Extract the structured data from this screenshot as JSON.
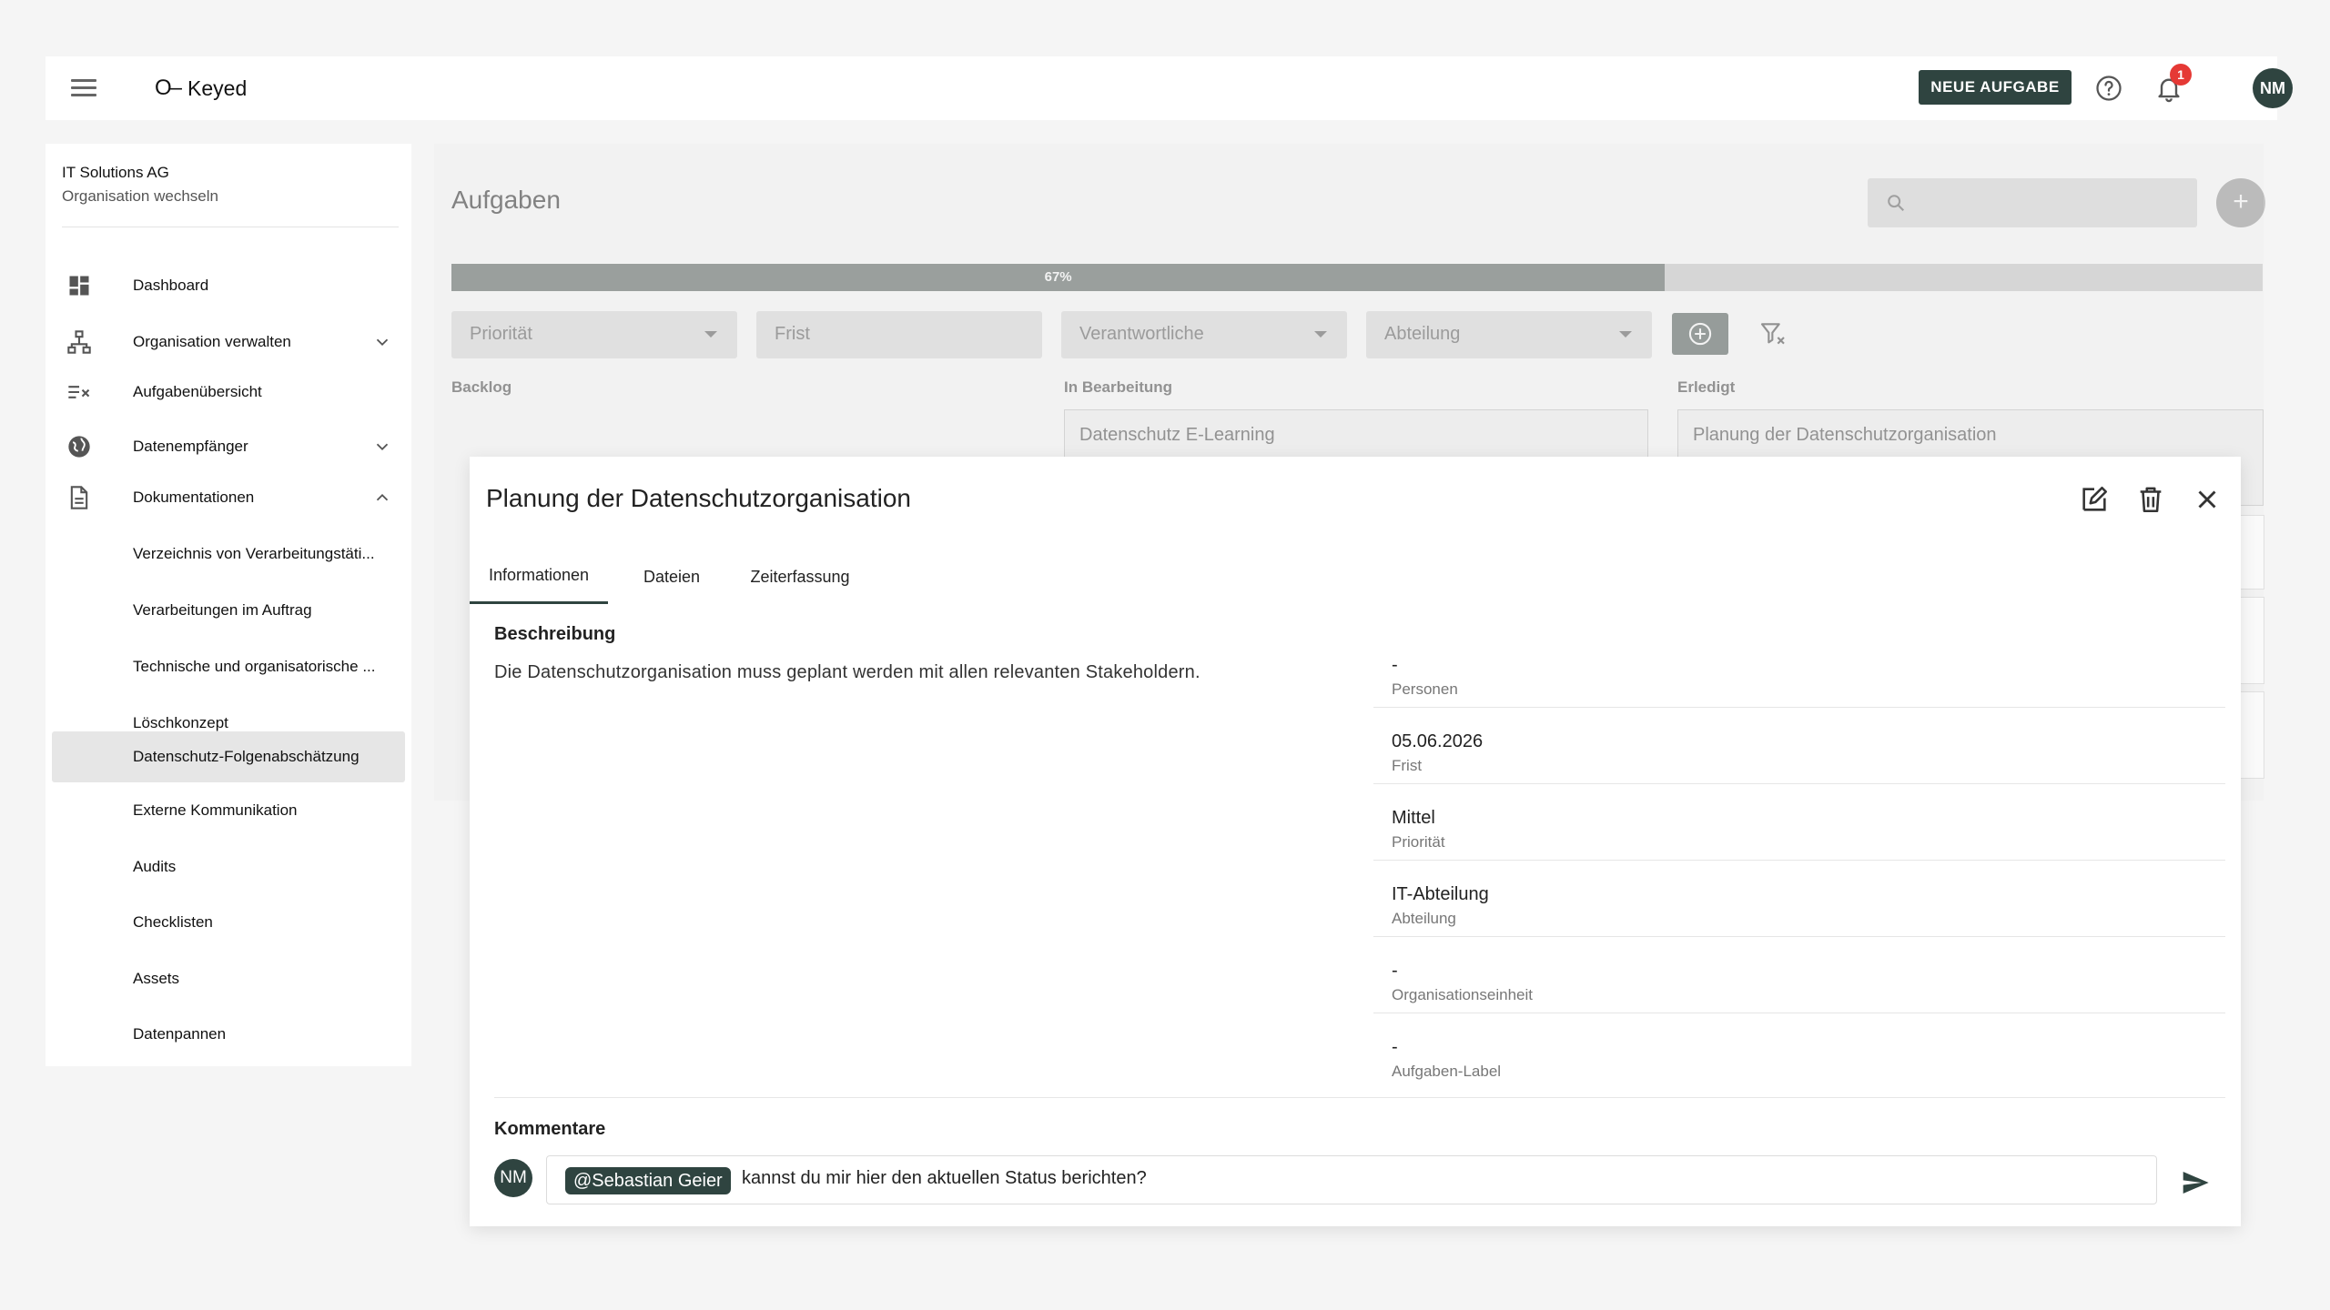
{
  "app": {
    "logo_mark": "O–",
    "name": "Keyed"
  },
  "header": {
    "new_task_label": "NEUE AUFGABE",
    "notification_count": "1",
    "user_initials": "NM"
  },
  "sidebar": {
    "org_name": "IT Solutions AG",
    "org_switch": "Organisation wechseln",
    "items": [
      {
        "label": "Dashboard",
        "icon": "dashboard-icon"
      },
      {
        "label": "Organisation verwalten",
        "icon": "org-tree-icon",
        "expandable": true
      },
      {
        "label": "Aufgabenübersicht",
        "icon": "task-list-icon"
      },
      {
        "label": "Datenempfänger",
        "icon": "globe-icon",
        "expandable": true
      },
      {
        "label": "Dokumentationen",
        "icon": "document-icon",
        "expanded": true
      },
      {
        "label": "Verzeichnis von Verarbeitungstäti..."
      },
      {
        "label": "Verarbeitungen im Auftrag"
      },
      {
        "label": "Technische und organisatorische ..."
      },
      {
        "label": "Löschkonzept"
      },
      {
        "label": "Datenschutz-Folgenabschätzung",
        "active": true
      },
      {
        "label": "Externe Kommunikation"
      },
      {
        "label": "Audits"
      },
      {
        "label": "Checklisten"
      },
      {
        "label": "Assets"
      },
      {
        "label": "Datenpannen"
      }
    ]
  },
  "main": {
    "title": "Aufgaben",
    "progress": {
      "percent": 67,
      "label": "67%"
    },
    "filters": {
      "priority": "Priorität",
      "deadline": "Frist",
      "responsible": "Verantwortliche",
      "department": "Abteilung"
    },
    "columns": {
      "backlog": "Backlog",
      "in_progress": "In Bearbeitung",
      "done": "Erledigt"
    },
    "cards": {
      "in_progress_first": "Datenschutz E-Learning",
      "done_first": "Planung der Datenschutzorganisation"
    }
  },
  "dialog": {
    "title": "Planung der Datenschutzorganisation",
    "tabs": [
      "Informationen",
      "Dateien",
      "Zeiterfassung"
    ],
    "active_tab": "Informationen",
    "description_title": "Beschreibung",
    "description": "Die Datenschutzorganisation muss geplant werden mit allen relevanten Stakeholdern.",
    "details": [
      {
        "value": "-",
        "label": "Personen"
      },
      {
        "value": "05.06.2026",
        "label": "Frist"
      },
      {
        "value": "Mittel",
        "label": "Priorität"
      },
      {
        "value": "IT-Abteilung",
        "label": "Abteilung"
      },
      {
        "value": "-",
        "label": "Organisationseinheit"
      },
      {
        "value": "-",
        "label": "Aufgaben-Label"
      }
    ],
    "comments_title": "Kommentare",
    "comment_avatar": "NM",
    "comment_mention": "@Sebastian Geier",
    "comment_text": "kannst du mir hier den aktuellen Status berichten?"
  },
  "colors": {
    "brand": "#2f4440",
    "badge": "#e53935",
    "active_nav": "#e6e6e6"
  }
}
